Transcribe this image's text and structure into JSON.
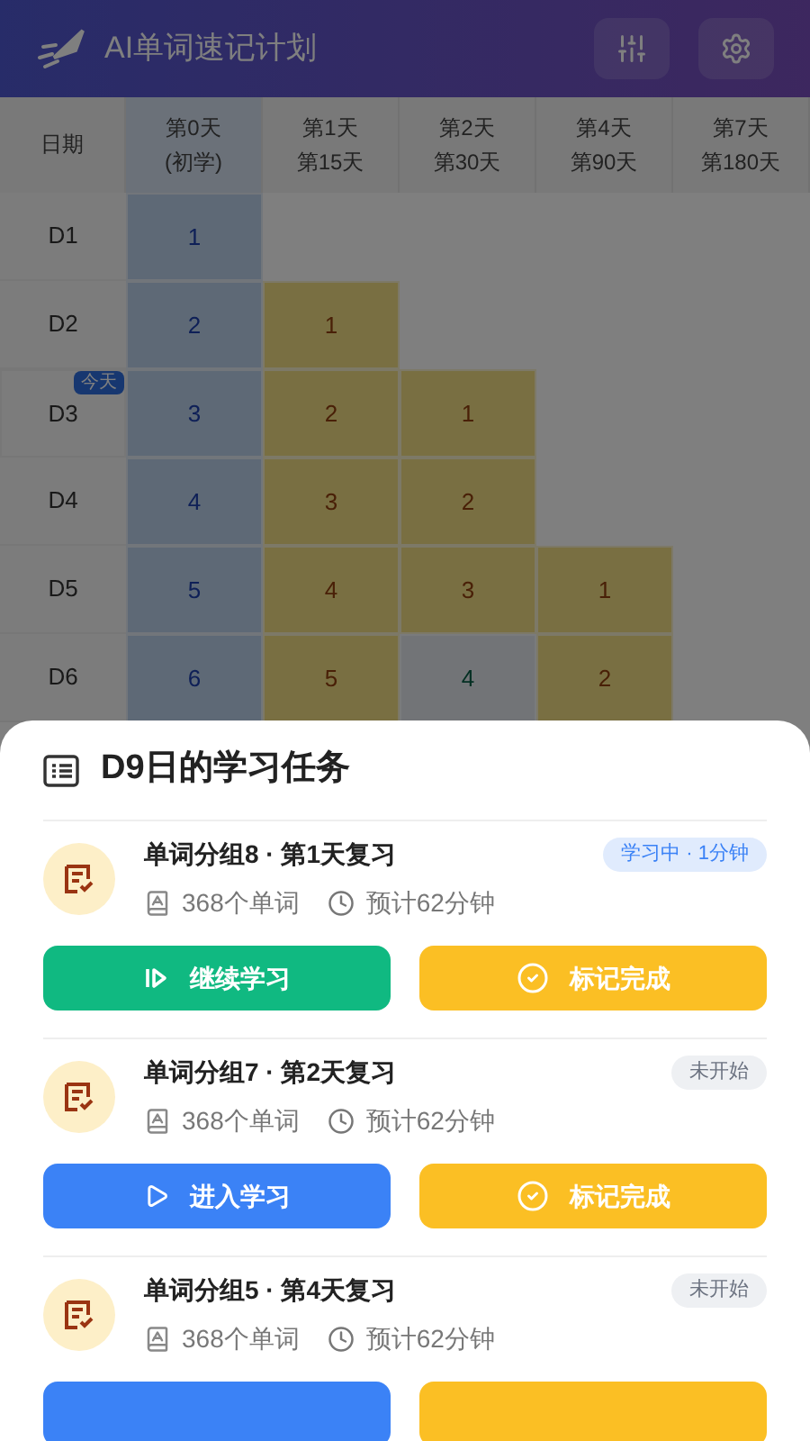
{
  "header": {
    "title": "AI单词速记计划"
  },
  "table": {
    "columns": [
      {
        "lines": [
          "日期"
        ]
      },
      {
        "lines": [
          "第0天",
          "(初学)"
        ],
        "kind": "new"
      },
      {
        "lines": [
          "第1天",
          "第15天"
        ]
      },
      {
        "lines": [
          "第2天",
          "第30天"
        ]
      },
      {
        "lines": [
          "第4天",
          "第90天"
        ]
      },
      {
        "lines": [
          "第7天",
          "第180天"
        ]
      }
    ],
    "rows": [
      {
        "cells": [
          {
            "kind": "date",
            "text": "D1",
            "today": false
          },
          {
            "kind": "new",
            "text": "1"
          },
          {
            "kind": "empty"
          },
          {
            "kind": "empty"
          },
          {
            "kind": "empty"
          },
          {
            "kind": "empty"
          }
        ]
      },
      {
        "cells": [
          {
            "kind": "date",
            "text": "D2",
            "today": false
          },
          {
            "kind": "new",
            "text": "2"
          },
          {
            "kind": "review",
            "text": "1"
          },
          {
            "kind": "empty"
          },
          {
            "kind": "empty"
          },
          {
            "kind": "empty"
          }
        ]
      },
      {
        "cells": [
          {
            "kind": "date",
            "text": "D3",
            "today": true,
            "badge": "今天"
          },
          {
            "kind": "new",
            "text": "3"
          },
          {
            "kind": "review",
            "text": "2"
          },
          {
            "kind": "review",
            "text": "1"
          },
          {
            "kind": "empty"
          },
          {
            "kind": "empty"
          }
        ]
      },
      {
        "cells": [
          {
            "kind": "date",
            "text": "D4",
            "today": false
          },
          {
            "kind": "new",
            "text": "4"
          },
          {
            "kind": "review",
            "text": "3"
          },
          {
            "kind": "review",
            "text": "2"
          },
          {
            "kind": "empty"
          },
          {
            "kind": "empty"
          }
        ]
      },
      {
        "cells": [
          {
            "kind": "date",
            "text": "D5",
            "today": false
          },
          {
            "kind": "new",
            "text": "5"
          },
          {
            "kind": "review",
            "text": "4"
          },
          {
            "kind": "review",
            "text": "3"
          },
          {
            "kind": "review",
            "text": "1"
          },
          {
            "kind": "empty"
          }
        ]
      },
      {
        "cells": [
          {
            "kind": "date",
            "text": "D6",
            "today": false
          },
          {
            "kind": "new",
            "text": "6"
          },
          {
            "kind": "review",
            "text": "5"
          },
          {
            "kind": "done",
            "text": "4"
          },
          {
            "kind": "review",
            "text": "2"
          },
          {
            "kind": "empty"
          }
        ]
      }
    ]
  },
  "sheet": {
    "title": "D9日的学习任务",
    "tasks": [
      {
        "title": "单词分组8 · 第1天复习",
        "status": {
          "kind": "active",
          "text": "学习中 · 1分钟"
        },
        "words": "368个单词",
        "time": "预计62分钟",
        "buttons": [
          {
            "kind": "continue",
            "label": "继续学习"
          },
          {
            "kind": "complete",
            "label": "标记完成"
          }
        ]
      },
      {
        "title": "单词分组7 · 第2天复习",
        "status": {
          "kind": "idle",
          "text": "未开始"
        },
        "words": "368个单词",
        "time": "预计62分钟",
        "buttons": [
          {
            "kind": "start",
            "label": "进入学习"
          },
          {
            "kind": "complete",
            "label": "标记完成"
          }
        ]
      },
      {
        "title": "单词分组5 · 第4天复习",
        "status": {
          "kind": "idle",
          "text": "未开始"
        },
        "words": "368个单词",
        "time": "预计62分钟",
        "buttons": [
          {
            "kind": "start"
          },
          {
            "kind": "complete"
          }
        ]
      }
    ]
  }
}
